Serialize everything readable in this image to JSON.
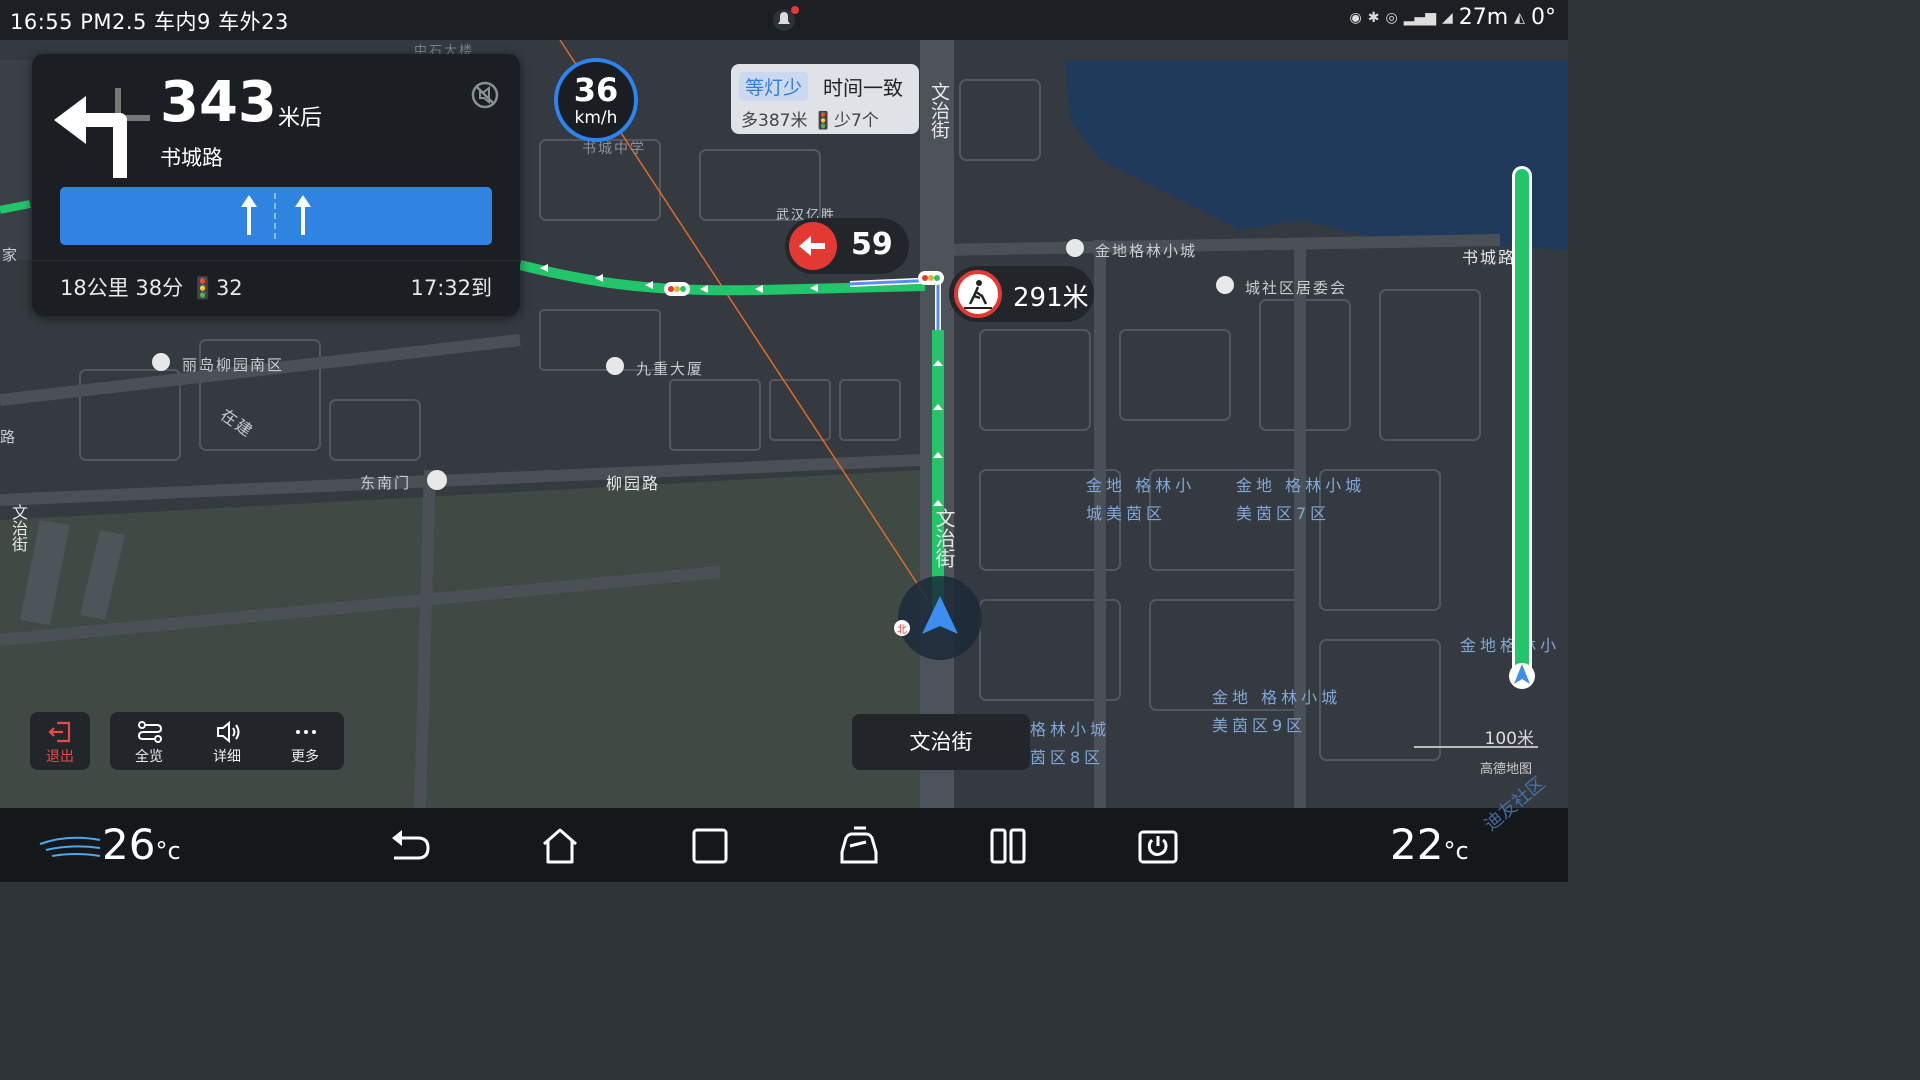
{
  "status_bar": {
    "left_text": "16:55 PM2.5 车内9 车外23",
    "right_text": "27m",
    "heading_text": "0°"
  },
  "guidance": {
    "distance": "343",
    "distance_unit": "米后",
    "road_name": "书城路",
    "trip_summary": "18公里  38分  🚦32",
    "eta": "17:32到"
  },
  "speed": {
    "value": "36",
    "unit": "km/h"
  },
  "route_bubble": {
    "tag": "等灯少",
    "title": "时间一致",
    "detail": "多387米  🚦少7个"
  },
  "traffic_light": {
    "countdown": "59"
  },
  "pedestrian_alert": {
    "distance": "291米"
  },
  "current_road": "文治街",
  "controls": {
    "exit_label": "退出",
    "overview_label": "全览",
    "detail_label": "详细",
    "more_label": "更多"
  },
  "scale": {
    "label": "100米",
    "provider": "高德地图"
  },
  "climate": {
    "left_temp": "26",
    "right_temp": "22",
    "unit": "°c"
  },
  "map_labels": {
    "liudao": "丽岛柳园南区",
    "zaijian": "在建",
    "dongnanmen": "东南门",
    "liuyuanlu": "柳园路",
    "jiuchong": "九重大厦",
    "wuhan": "武汉亿胜",
    "shucheng_mid": "书城中学",
    "wenzhi_top": "文治街",
    "wenzhi_mid": "文治街",
    "wenzhi_left": "文治街",
    "jindi_top": "金地格林小城",
    "chengshe": "城社区居委会",
    "shucheng_right": "书城路",
    "jindi_meiyin": "金地 格林小城美茵区",
    "jindi_7": "金地 格林小城美茵区7区",
    "jindi_9": "金地 格林小城美茵区9区",
    "jindi_8": "格林小城 茵区8区",
    "jindi_right": "金地格林小",
    "zhongshi": "中石大楼",
    "jia": "家",
    "lu": "路",
    "north": "北"
  },
  "colors": {
    "route_green": "#22c56a",
    "accent_blue": "#2e84e0",
    "alert_red": "#e23a33",
    "water": "#1f3a5a"
  },
  "icons": [
    "turn-left-icon",
    "mute-icon",
    "lane-straight-icon",
    "traffic-light-icon",
    "pedestrian-icon",
    "exit-icon",
    "overview-icon",
    "speaker-icon",
    "more-icon",
    "back-icon",
    "home-icon",
    "recents-icon",
    "car-icon",
    "split-screen-icon",
    "power-icon",
    "vehicle-cursor-icon"
  ],
  "watermark": "迪友社区"
}
